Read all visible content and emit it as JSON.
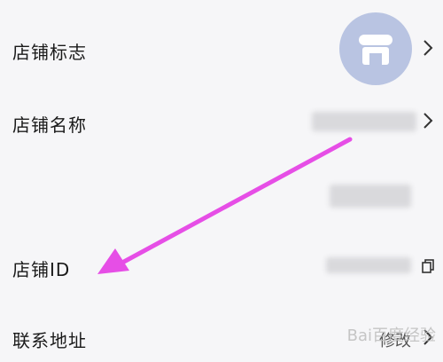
{
  "rows": [
    {
      "label": "店铺标志"
    },
    {
      "label": "店铺名称"
    },
    {
      "label": "店铺ID"
    },
    {
      "label": "联系地址",
      "action": "修改"
    }
  ],
  "watermark": "Bai百度经验",
  "colors": {
    "background": "#f6f6f8",
    "avatar": "#b9c4e2",
    "arrow": "#e64ee6",
    "text": "#1a1a1a"
  },
  "icons": [
    "store-icon",
    "chevron-right-icon",
    "copy-icon"
  ]
}
